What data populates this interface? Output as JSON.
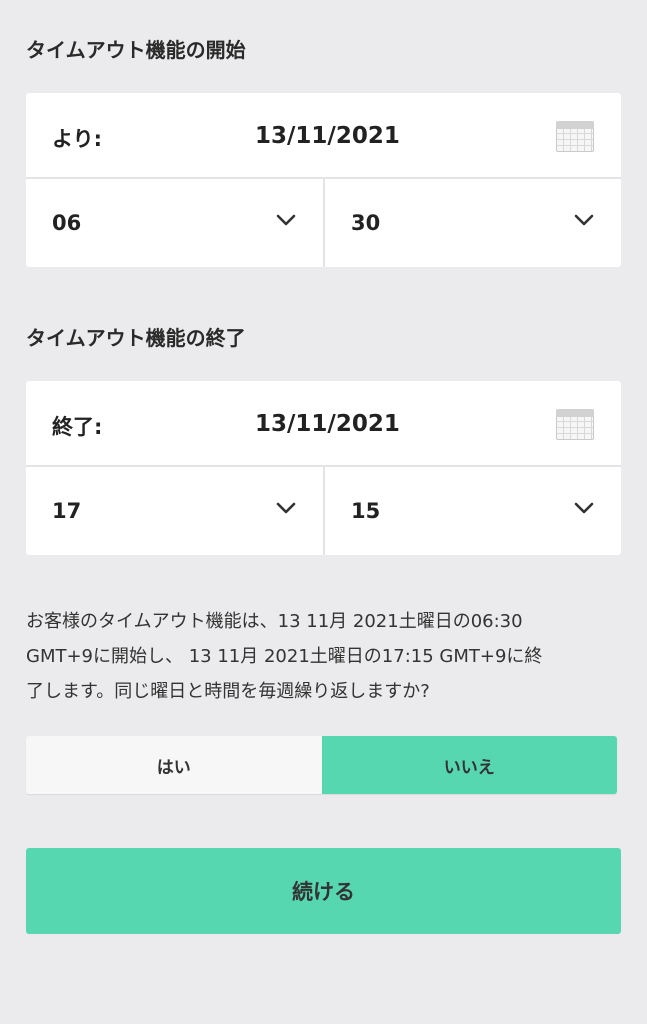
{
  "start": {
    "title": "タイムアウト機能の開始",
    "date_label": "より:",
    "date_value": "13/11/2021",
    "hour": "06",
    "minute": "30"
  },
  "end": {
    "title": "タイムアウト機能の終了",
    "date_label": "終了:",
    "date_value": "13/11/2021",
    "hour": "17",
    "minute": "15"
  },
  "info": {
    "line1": "お客様のタイムアウト機能は、13 11月 2021土曜日の06:30",
    "line2": "GMT+9に開始し、 13 11月 2021土曜日の17:15 GMT+9に終",
    "line3": "了します。同じ曜日と時間を毎週繰り返しますか?"
  },
  "repeat_toggle": {
    "yes_label": "はい",
    "no_label": "いいえ",
    "selected": "no"
  },
  "continue_label": "続ける",
  "colors": {
    "accent": "#57d7b0",
    "background": "#ebebed",
    "card": "#ffffff"
  },
  "icons": {
    "calendar": "calendar-icon",
    "chevron": "chevron-down-icon"
  }
}
